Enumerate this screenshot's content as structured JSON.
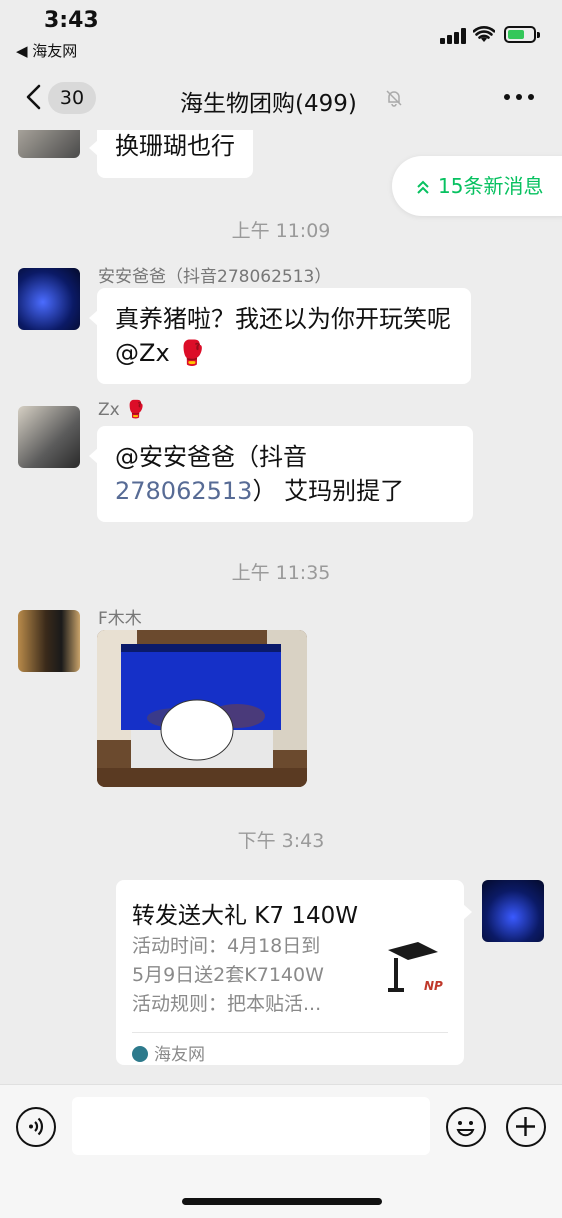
{
  "status": {
    "time": "3:43",
    "back_app": "◀ 海友网"
  },
  "nav": {
    "unread_count": "30",
    "title": "海生物团购(499)"
  },
  "chat": {
    "new_messages": "15条新消息",
    "messages": [
      {
        "text": "换珊瑚也行"
      },
      {
        "sender": "安安爸爸（抖音278062513）",
        "text": "真养猪啦？我还以为你开玩笑呢 @Zx 🥊"
      },
      {
        "sender": "Zx 🥊",
        "text_prefix": "@安安爸爸（抖音",
        "text_link": "278062513",
        "text_suffix": "） 艾玛别提了"
      },
      {
        "sender": "F木木"
      },
      {
        "card_title": "转发送大礼 K7 140W",
        "card_lines": [
          "活动时间：4月18日到",
          "5月9日送2套K7140W",
          "活动规则：把本贴活..."
        ],
        "card_source": "海友网"
      }
    ],
    "timestamps": [
      "上午 11:09",
      "上午 11:35",
      "下午 3:43"
    ]
  },
  "colors": {
    "accent": "#07c160",
    "link": "#576b95",
    "background": "#ededed"
  }
}
